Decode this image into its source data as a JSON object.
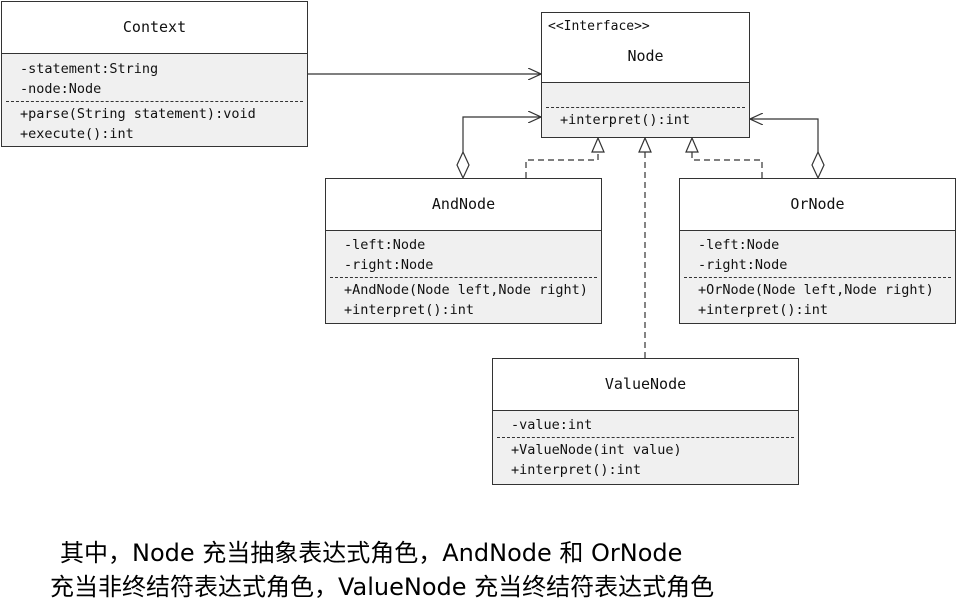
{
  "classes": {
    "context": {
      "name": "Context",
      "attributes": [
        "-statement:String",
        "-node:Node"
      ],
      "methods": [
        "+parse(String statement):void",
        "+execute():int"
      ]
    },
    "node": {
      "stereotype": "<<Interface>>",
      "name": "Node",
      "methods": [
        "+interpret():int"
      ]
    },
    "and_node": {
      "name": "AndNode",
      "attributes": [
        "-left:Node",
        "-right:Node"
      ],
      "methods": [
        "+AndNode(Node left,Node right)",
        "+interpret():int"
      ]
    },
    "or_node": {
      "name": "OrNode",
      "attributes": [
        "-left:Node",
        "-right:Node"
      ],
      "methods": [
        "+OrNode(Node left,Node right)",
        "+interpret():int"
      ]
    },
    "value_node": {
      "name": "ValueNode",
      "attributes": [
        "-value:int"
      ],
      "methods": [
        "+ValueNode(int value)",
        "+interpret():int"
      ]
    }
  },
  "caption": {
    "line1": "其中，Node 充当抽象表达式角色，AndNode 和 OrNode",
    "line2": "充当非终结符表达式角色，ValueNode 充当终结符表达式角色"
  }
}
